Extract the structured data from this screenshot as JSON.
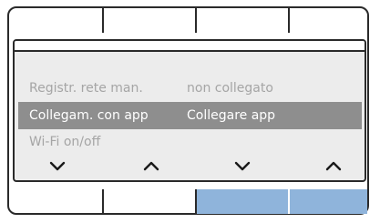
{
  "screen": {
    "rows": [
      {
        "col1": "Registr. rete man.",
        "col2": "non collegato",
        "selected": false
      },
      {
        "col1": "Collegam. con app",
        "col2": "Collegare app",
        "selected": true
      },
      {
        "col1": "Wi-Fi on/off",
        "col2": "",
        "selected": false
      }
    ]
  },
  "nav": [
    {
      "icon": "chevron-down-icon"
    },
    {
      "icon": "chevron-up-icon"
    },
    {
      "icon": "chevron-down-icon"
    },
    {
      "icon": "chevron-up-icon"
    }
  ],
  "colors": {
    "highlight": "#8e8e8e",
    "softkey_active": "#8fb4db",
    "text_dim": "#a5a5a5"
  }
}
